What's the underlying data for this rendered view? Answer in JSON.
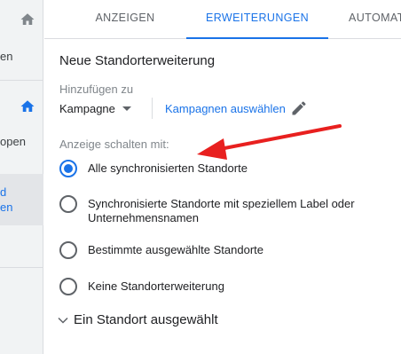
{
  "sidebar": {
    "items": [
      {
        "label": "en"
      },
      {
        "label": "open"
      },
      {
        "label_line1": "d",
        "label_line2": "en"
      }
    ]
  },
  "tabs": [
    {
      "label": "ANZEIGEN"
    },
    {
      "label": "ERWEITERUNGEN"
    },
    {
      "label": "AUTOMAT"
    }
  ],
  "form": {
    "heading": "Neue Standorterweiterung",
    "add_to_label": "Hinzufügen zu",
    "add_to_value": "Kampagne",
    "select_campaigns_link": "Kampagnen auswählen",
    "serve_with_label": "Anzeige schalten mit:",
    "options": [
      {
        "label": "Alle synchronisierten Standorte"
      },
      {
        "label": "Synchronisierte Standorte mit speziellem Label oder Unternehmensnamen"
      },
      {
        "label": "Bestimmte ausgewählte Standorte"
      },
      {
        "label": "Keine Standorterweiterung"
      }
    ],
    "selected_option_index": 0,
    "location_summary": "Ein Standort ausgewählt"
  },
  "colors": {
    "accent": "#1a73e8",
    "annotation_arrow": "#e8201f"
  }
}
